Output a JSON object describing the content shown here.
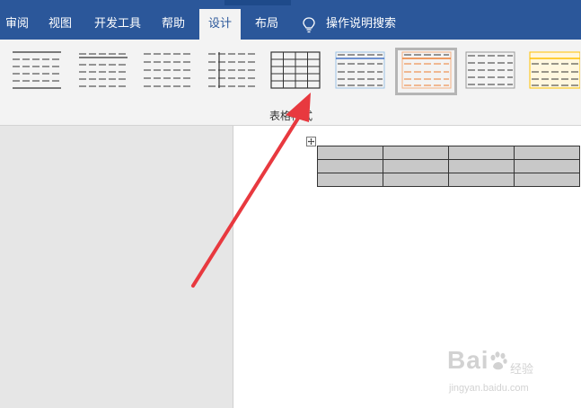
{
  "ribbon": {
    "tabs": [
      {
        "label": "审阅"
      },
      {
        "label": "视图"
      },
      {
        "label": "开发工具"
      },
      {
        "label": "帮助"
      },
      {
        "label": "设计",
        "active": true
      },
      {
        "label": "布局"
      }
    ],
    "search_label": "操作说明搜索",
    "search_icon": "lightbulb-icon",
    "group_label": "表格样式"
  },
  "table_styles": [
    {
      "line_color": "#333333",
      "accent": "none"
    },
    {
      "line_color": "#333333",
      "accent": "none"
    },
    {
      "line_color": "#333333",
      "accent": "none"
    },
    {
      "line_color": "#333333",
      "accent": "none"
    },
    {
      "line_color": "#333333",
      "accent": "grid"
    },
    {
      "line_color": "#4472c4",
      "accent": "blue"
    },
    {
      "line_color": "#ed7d31",
      "accent": "orange",
      "selected": true
    },
    {
      "line_color": "#555555",
      "accent": "none"
    },
    {
      "line_color": "#ffc000",
      "accent": "gold"
    }
  ],
  "document": {
    "table": {
      "rows": 3,
      "cols": 4,
      "fill": "#c8c8c8"
    }
  },
  "annotation": {
    "arrow_color": "#e8393f"
  },
  "watermark": {
    "brand": "Bai",
    "cn": "经验",
    "url": "jingyan.baidu.com"
  }
}
